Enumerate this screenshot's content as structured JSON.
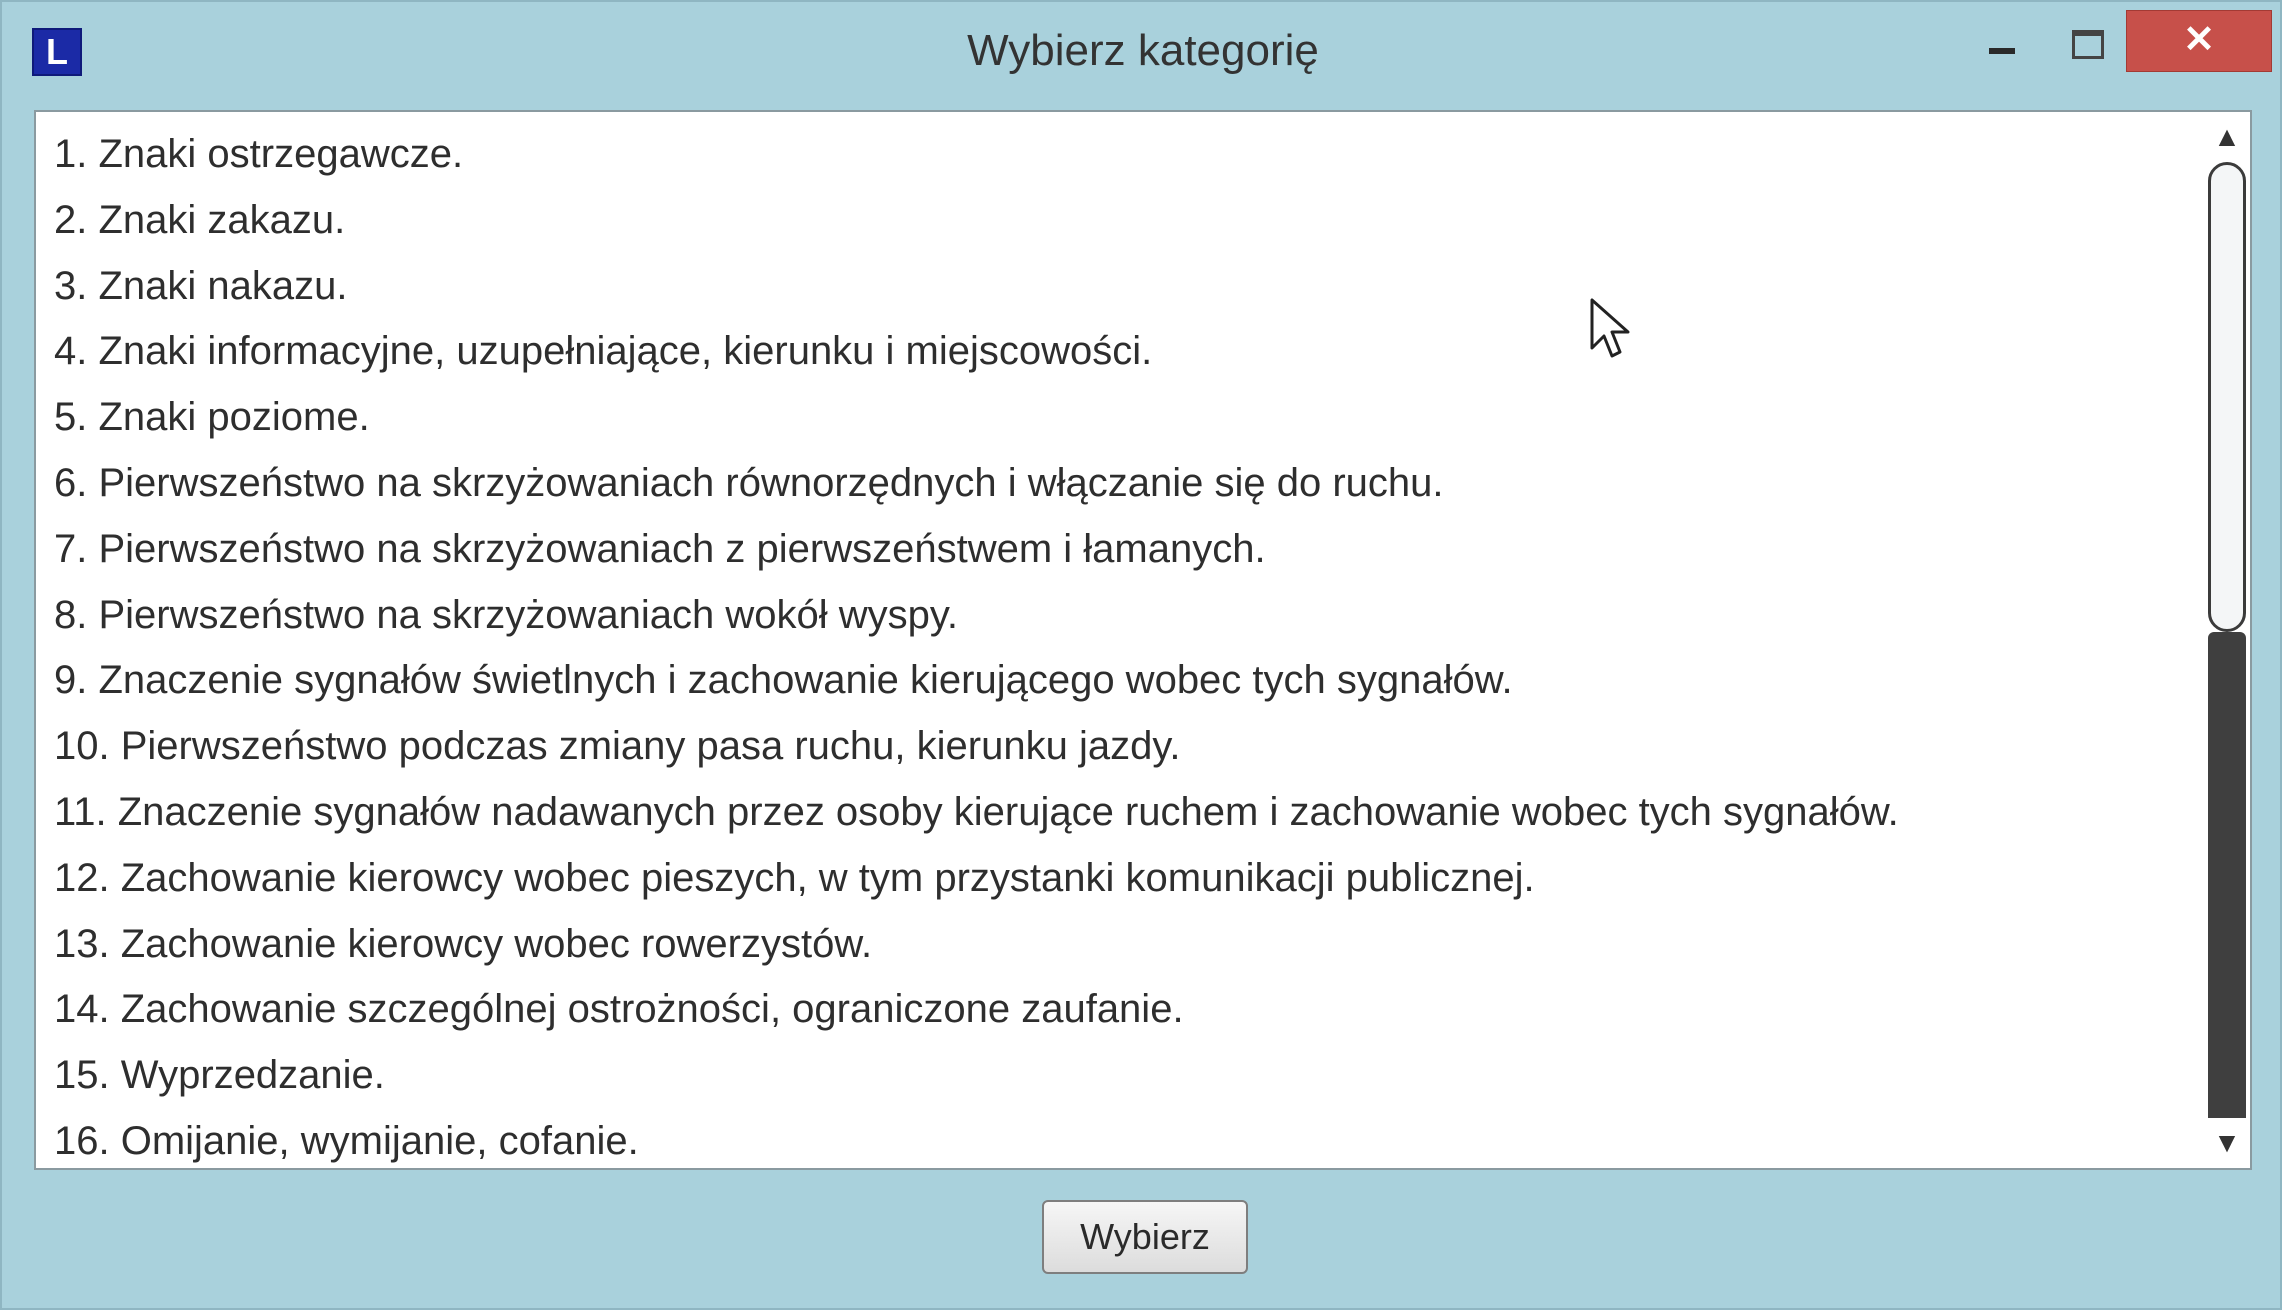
{
  "window": {
    "title": "Wybierz kategorię",
    "app_icon_letter": "L",
    "close_glyph": "✕",
    "accent_color": "#a9d1dc",
    "close_color": "#c7504a"
  },
  "categories": [
    "1. Znaki ostrzegawcze.",
    "2. Znaki zakazu.",
    "3. Znaki nakazu.",
    "4. Znaki informacyjne, uzupełniające, kierunku i miejscowości.",
    "5. Znaki poziome.",
    "6. Pierwszeństwo na skrzyżowaniach równorzędnych i włączanie się do ruchu.",
    "7. Pierwszeństwo na skrzyżowaniach z pierwszeństwem i łamanych.",
    "8. Pierwszeństwo na skrzyżowaniach wokół wyspy.",
    "9. Znaczenie sygnałów świetlnych i zachowanie kierującego wobec tych sygnałów.",
    "10. Pierwszeństwo podczas zmiany pasa ruchu, kierunku jazdy.",
    "11. Znaczenie sygnałów nadawanych przez osoby kierujące ruchem i zachowanie wobec tych sygnałów.",
    "12. Zachowanie kierowcy wobec pieszych, w tym przystanki komunikacji publicznej.",
    "13. Zachowanie kierowcy wobec rowerzystów.",
    "14. Zachowanie szczególnej ostrożności, ograniczone zaufanie.",
    "15. Wyprzedzanie.",
    "16. Omijanie, wymijanie, cofanie."
  ],
  "scrollbar": {
    "up_glyph": "▲",
    "down_glyph": "▼",
    "position_fraction": 0.0
  },
  "footer": {
    "select_label": "Wybierz"
  }
}
